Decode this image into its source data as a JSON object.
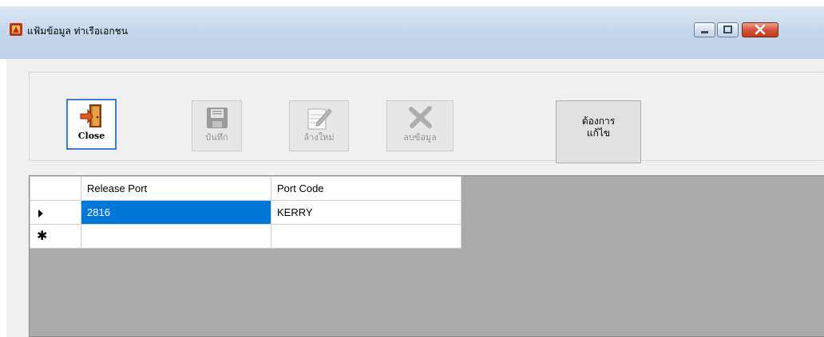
{
  "window": {
    "title": "แฟ้มข้อมูล ท่าเรือเอกชน",
    "controls": {
      "minimize": "minimize-icon",
      "maximize": "maximize-icon",
      "close": "close-icon"
    }
  },
  "toolbar": {
    "close_label": "Close",
    "save_label": "บันทึก",
    "clear_label": "ล้างใหม่",
    "delete_label": "ลบข้อมูล",
    "edit_label": "ต้องการแก้ไข",
    "edit_label_line1": "ต้องการ",
    "edit_label_line2": "แก้ไข"
  },
  "grid": {
    "columns": [
      "Release Port",
      "Port Code"
    ],
    "rows": [
      {
        "release_port": "2816",
        "port_code": "KERRY",
        "selected": true
      },
      {
        "release_port": "",
        "port_code": "",
        "new_row": true
      }
    ],
    "selection_color": "#0078d7"
  }
}
